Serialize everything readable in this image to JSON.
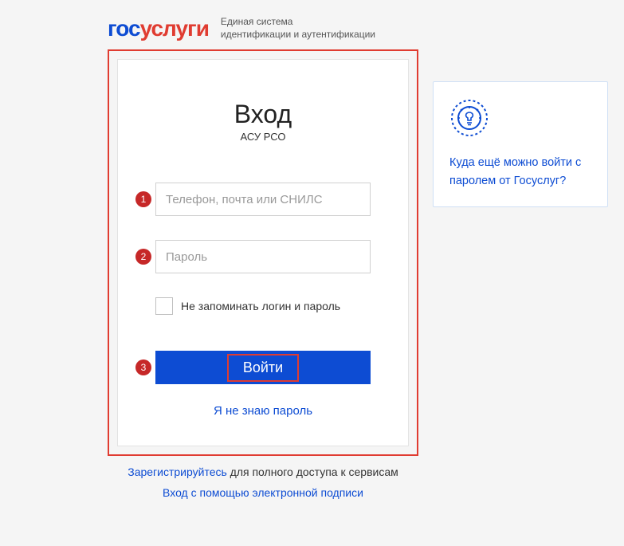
{
  "header": {
    "logo_gos": "гос",
    "logo_uslugi": "услуги",
    "tagline_line1": "Единая система",
    "tagline_line2": "идентификации и аутентификации"
  },
  "login": {
    "title": "Вход",
    "subtitle": "АСУ РСО",
    "login_placeholder": "Телефон, почта или СНИЛС",
    "password_placeholder": "Пароль",
    "dont_remember_label": "Не запоминать логин и пароль",
    "submit_label": "Войти",
    "forgot_label": "Я не знаю пароль"
  },
  "annotations": {
    "badge1": "1",
    "badge2": "2",
    "badge3": "3"
  },
  "sidebar": {
    "help_link": "Куда ещё можно войти с паролем от Госуслуг?"
  },
  "footer": {
    "register_link": "Зарегистрируйтесь",
    "register_rest": " для полного доступа к сервисам",
    "esign_link": "Вход с помощью электронной подписи"
  }
}
